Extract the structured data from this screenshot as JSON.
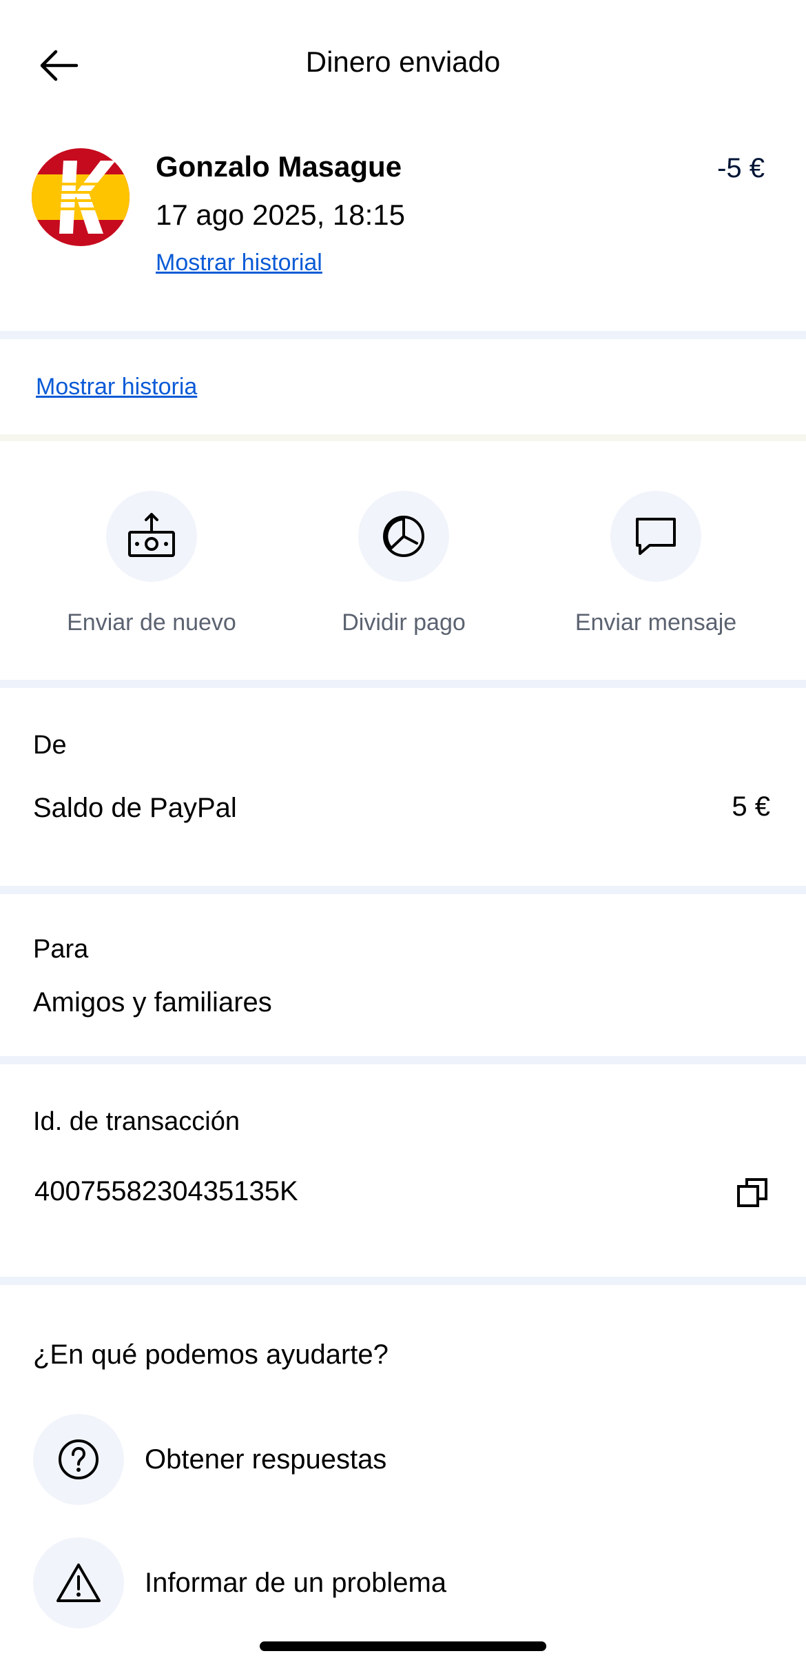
{
  "header": {
    "title": "Dinero enviado",
    "back_icon": "arrow-left-icon"
  },
  "payee": {
    "name": "Gonzalo Masague",
    "date": "17 ago 2025, 18:15",
    "history_link": "Mostrar historial",
    "amount": "-5 €",
    "avatar_letter": "K"
  },
  "story_link": "Mostrar historia",
  "actions": [
    {
      "label": "Enviar de nuevo",
      "icon": "send-money-icon"
    },
    {
      "label": "Dividir pago",
      "icon": "pie-chart-icon"
    },
    {
      "label": "Enviar mensaje",
      "icon": "message-icon"
    }
  ],
  "from": {
    "label": "De",
    "source": "Saldo de PayPal",
    "amount": "5 €"
  },
  "to": {
    "label": "Para",
    "value": "Amigos y familiares"
  },
  "transaction": {
    "label": "Id. de transacción",
    "id": "4007558230435135K",
    "copy_icon": "copy-icon"
  },
  "help": {
    "title": "¿En qué podemos ayudarte?",
    "items": [
      {
        "label": "Obtener respuestas",
        "icon": "question-icon"
      },
      {
        "label": "Informar de un problema",
        "icon": "warning-icon"
      }
    ]
  },
  "colors": {
    "link": "#0a5bd6",
    "divider": "#eef2fb",
    "amount": "#001435",
    "icon_bg": "#f1f4fa"
  }
}
